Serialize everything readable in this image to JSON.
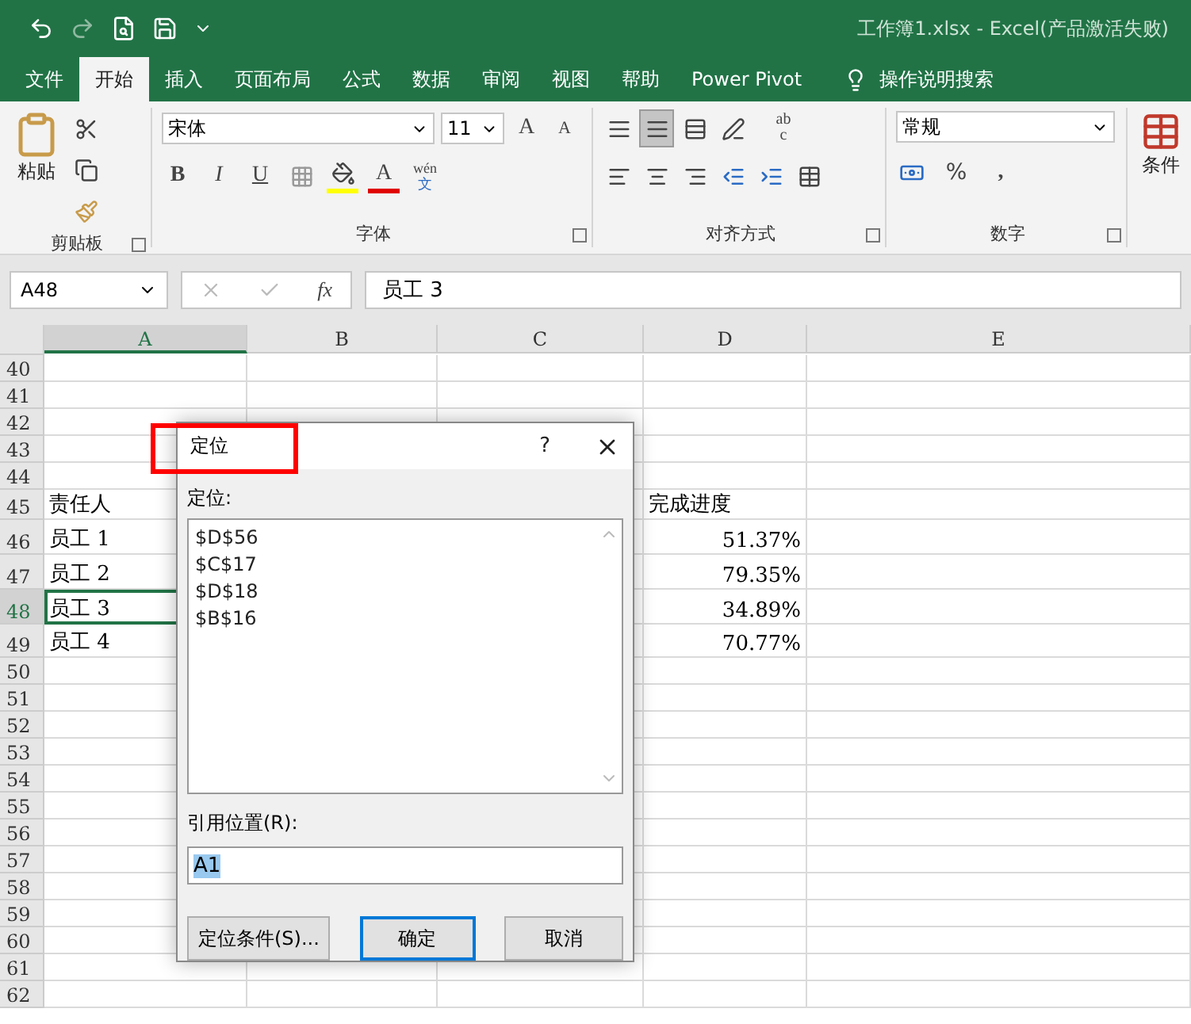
{
  "title_bar": {
    "document_title": "工作簿1.xlsx  -  Excel(产品激活失败)"
  },
  "menu_tabs": [
    {
      "label": "文件",
      "selected": false
    },
    {
      "label": "开始",
      "selected": true
    },
    {
      "label": "插入",
      "selected": false
    },
    {
      "label": "页面布局",
      "selected": false
    },
    {
      "label": "公式",
      "selected": false
    },
    {
      "label": "数据",
      "selected": false
    },
    {
      "label": "审阅",
      "selected": false
    },
    {
      "label": "视图",
      "selected": false
    },
    {
      "label": "帮助",
      "selected": false
    },
    {
      "label": "Power Pivot",
      "selected": false
    }
  ],
  "tell_me": "操作说明搜索",
  "ribbon": {
    "clipboard": {
      "paste": "粘贴",
      "group": "剪贴板"
    },
    "font": {
      "name": "宋体",
      "size": "11",
      "grow": "A",
      "shrink": "A",
      "bold": "B",
      "italic": "I",
      "underline": "U",
      "color_letter": "A",
      "phonetic_top": "wén",
      "phonetic_bottom": "文",
      "group": "字体"
    },
    "alignment": {
      "group": "对齐方式",
      "wrap_top": "ab",
      "wrap_bottom": "c"
    },
    "number": {
      "format": "常规",
      "percent": "%",
      "comma": ",",
      "group": "数字"
    },
    "styles": {
      "conditional": "条件"
    }
  },
  "formula_bar": {
    "name_box": "A48",
    "fx": "fx",
    "value": "员工 3"
  },
  "columns": [
    {
      "label": "A",
      "selected": true
    },
    {
      "label": "B",
      "selected": false
    },
    {
      "label": "C",
      "selected": false
    },
    {
      "label": "D",
      "selected": false
    },
    {
      "label": "E",
      "selected": false
    }
  ],
  "rows": [
    {
      "number": "40",
      "selected": false
    },
    {
      "number": "41",
      "selected": false
    },
    {
      "number": "42",
      "selected": false
    },
    {
      "number": "43",
      "selected": false
    },
    {
      "number": "44",
      "selected": false
    },
    {
      "number": "45",
      "selected": false,
      "A": {
        "text": "责任人"
      },
      "D": {
        "text": "完成进度",
        "kind": "text"
      }
    },
    {
      "number": "46",
      "selected": false,
      "A": {
        "text": "员工 1"
      },
      "D": {
        "text": "51.37%",
        "kind": "number"
      }
    },
    {
      "number": "47",
      "selected": false,
      "A": {
        "text": "员工 2"
      },
      "D": {
        "text": "79.35%",
        "kind": "number"
      }
    },
    {
      "number": "48",
      "selected": true,
      "A": {
        "text": "员工 3"
      },
      "D": {
        "text": "34.89%",
        "kind": "number"
      }
    },
    {
      "number": "49",
      "selected": false,
      "A": {
        "text": "员工 4"
      },
      "D": {
        "text": "70.77%",
        "kind": "number"
      }
    },
    {
      "number": "50",
      "selected": false
    },
    {
      "number": "51",
      "selected": false
    },
    {
      "number": "52",
      "selected": false
    },
    {
      "number": "53",
      "selected": false
    },
    {
      "number": "54",
      "selected": false
    },
    {
      "number": "55",
      "selected": false
    },
    {
      "number": "56",
      "selected": false
    },
    {
      "number": "57",
      "selected": false
    },
    {
      "number": "58",
      "selected": false
    },
    {
      "number": "59",
      "selected": false
    },
    {
      "number": "60",
      "selected": false
    },
    {
      "number": "61",
      "selected": false
    },
    {
      "number": "62",
      "selected": false
    }
  ],
  "dialog": {
    "title": "定位",
    "help": "?",
    "list_label": "定位:",
    "references": [
      "$D$56",
      "$C$17",
      "$D$18",
      "$B$16"
    ],
    "reference_label": "引用位置(R):",
    "reference_value": "A1",
    "value_selected": true,
    "buttons": [
      {
        "label": "定位条件(S)...",
        "default": false
      },
      {
        "label": "确定",
        "default": true
      },
      {
        "label": "取消",
        "default": false
      }
    ],
    "title_highlighted": true
  }
}
